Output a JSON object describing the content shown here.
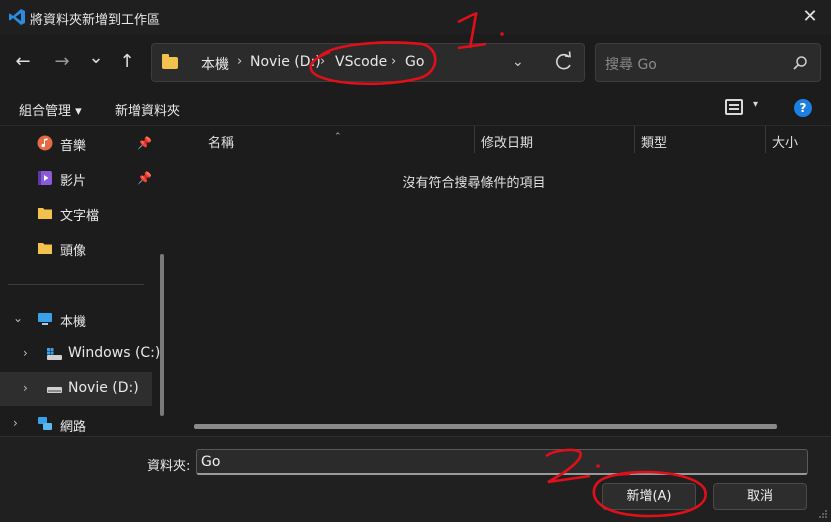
{
  "window": {
    "title": "將資料夾新增到工作區",
    "close_glyph": "✕"
  },
  "nav": {
    "back_glyph": "←",
    "forward_glyph": "→",
    "recent_glyph": "⌄",
    "up_glyph": "↑",
    "breadcrumb": [
      "本機",
      "Novie (D:)",
      "VScode",
      "Go"
    ],
    "separator": "›",
    "dropdown_glyph": "⌄",
    "search_placeholder": "搜尋 Go"
  },
  "toolbar": {
    "organize": "組合管理 ▾",
    "new_folder": "新增資料夾",
    "view_dd": "▾",
    "help": "?"
  },
  "sidebar": {
    "items": [
      {
        "label": "音樂",
        "pin": "📌"
      },
      {
        "label": "影片",
        "pin": "📌"
      },
      {
        "label": "文字檔"
      },
      {
        "label": "頭像"
      },
      {
        "label": "本機",
        "chev": "⌄"
      },
      {
        "label": "Windows (C:)",
        "chev": "›"
      },
      {
        "label": "Novie (D:)",
        "chev": "›"
      },
      {
        "label": "網路",
        "chev": "›"
      }
    ]
  },
  "columns": {
    "name": "名稱",
    "modified": "修改日期",
    "type": "類型",
    "size": "大小"
  },
  "empty_message": "沒有符合搜尋條件的項目",
  "footer": {
    "folder_label": "資料夾:",
    "folder_value": "Go",
    "add_button": "新增(A)",
    "cancel_button": "取消"
  },
  "annotations": {
    "step1": "1.",
    "step2": "2."
  },
  "colors": {
    "accent": "#1d7fe0",
    "annotation": "#e0101a",
    "folder": "#f2c14e",
    "background": "#1c1c1c"
  }
}
